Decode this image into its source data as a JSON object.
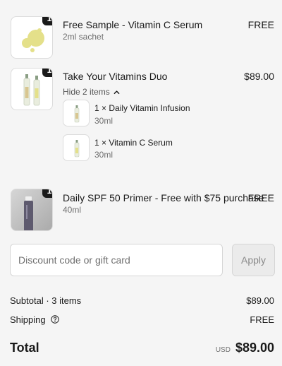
{
  "line_items": [
    {
      "quantity": "1",
      "title": "Free Sample - Vitamin C Serum",
      "variant": "2ml sachet",
      "price": "FREE",
      "image_icon": "serum-drops-icon"
    },
    {
      "quantity": "1",
      "title": "Take Your Vitamins Duo",
      "price": "$89.00",
      "image_icon": "serum-bottles-icon",
      "toggle_label": "Hide 2 items",
      "components": [
        {
          "label": "1 × Daily Vitamin Infusion",
          "size": "30ml",
          "image_icon": "bottle-icon"
        },
        {
          "label": "1 × Vitamin C Serum",
          "size": "30ml",
          "image_icon": "bottle-icon"
        }
      ]
    },
    {
      "quantity": "1",
      "title": "Daily SPF 50 Primer - Free with $75 purchase",
      "variant": "40ml",
      "price": "FREE",
      "image_icon": "primer-tube-icon"
    }
  ],
  "discount": {
    "placeholder": "Discount code or gift card",
    "value": "",
    "apply_label": "Apply"
  },
  "summary": {
    "subtotal_label": "Subtotal · 3 items",
    "subtotal_value": "$89.00",
    "shipping_label": "Shipping",
    "shipping_value": "FREE",
    "total_label": "Total",
    "currency": "USD",
    "total_value": "$89.00"
  },
  "colors": {
    "background": "#f5f5f5",
    "badge": "#1a1a1a",
    "muted_text": "#707070",
    "serum_yellow": "#e4e08a"
  }
}
